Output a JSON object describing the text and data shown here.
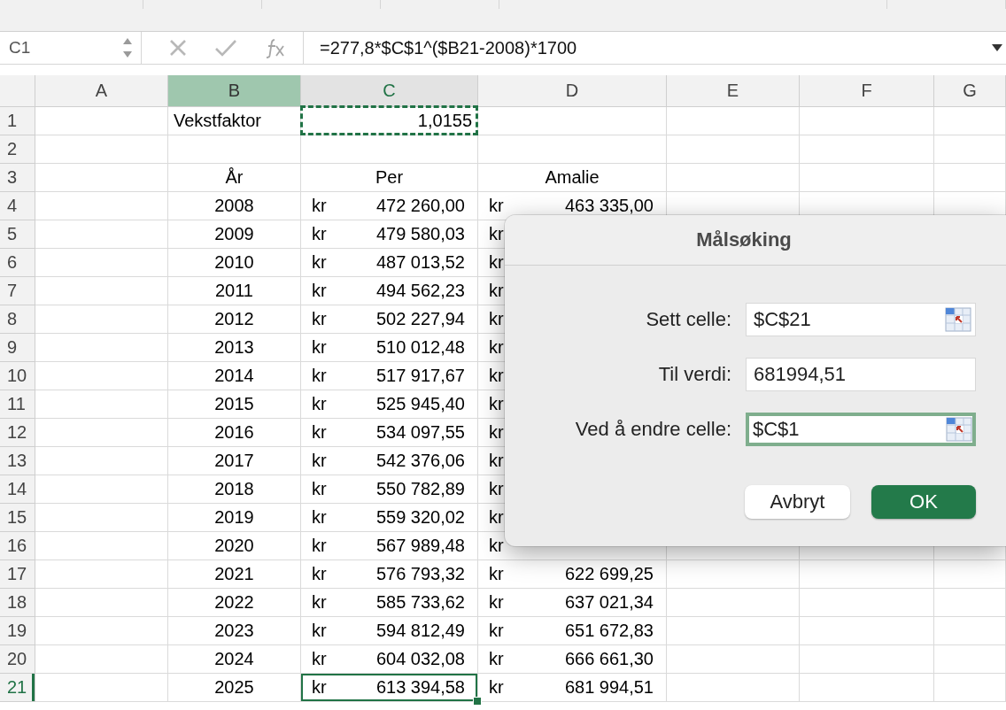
{
  "formula_bar": {
    "name_box": "C1",
    "cancel_enabled": false,
    "enter_enabled": false,
    "formula": "=277,8*$C$1^($B21-2008)*1700"
  },
  "columns": [
    {
      "label": "A",
      "selected": false,
      "highlighted": false
    },
    {
      "label": "B",
      "selected": false,
      "highlighted": true
    },
    {
      "label": "C",
      "selected": true,
      "highlighted": false
    },
    {
      "label": "D",
      "selected": false,
      "highlighted": false
    },
    {
      "label": "E",
      "selected": false,
      "highlighted": false
    },
    {
      "label": "F",
      "selected": false,
      "highlighted": false
    },
    {
      "label": "G",
      "selected": false,
      "highlighted": false
    }
  ],
  "rows": [
    {
      "number": "1",
      "current": false,
      "kind": "input",
      "b": "Vekstfaktor",
      "c": {
        "value": "1,0155",
        "marquee": true
      }
    },
    {
      "number": "2",
      "current": false,
      "kind": "blank"
    },
    {
      "number": "3",
      "current": false,
      "kind": "header",
      "b": "År",
      "c": "Per",
      "d": "Amalie"
    },
    {
      "number": "4",
      "current": false,
      "kind": "data",
      "b": "2008",
      "c": {
        "currency": "kr",
        "amount": "472 260,00",
        "active": false
      },
      "d": {
        "currency": "kr",
        "amount": "463 335,00"
      }
    },
    {
      "number": "5",
      "current": false,
      "kind": "data",
      "b": "2009",
      "c": {
        "currency": "kr",
        "amount": "479 580,03",
        "active": false
      },
      "d": {
        "currency": "kr"
      }
    },
    {
      "number": "6",
      "current": false,
      "kind": "data",
      "b": "2010",
      "c": {
        "currency": "kr",
        "amount": "487 013,52",
        "active": false
      },
      "d": {
        "currency": "kr"
      }
    },
    {
      "number": "7",
      "current": false,
      "kind": "data",
      "b": "2011",
      "c": {
        "currency": "kr",
        "amount": "494 562,23",
        "active": false
      },
      "d": {
        "currency": "kr"
      }
    },
    {
      "number": "8",
      "current": false,
      "kind": "data",
      "b": "2012",
      "c": {
        "currency": "kr",
        "amount": "502 227,94",
        "active": false
      },
      "d": {
        "currency": "kr"
      }
    },
    {
      "number": "9",
      "current": false,
      "kind": "data",
      "b": "2013",
      "c": {
        "currency": "kr",
        "amount": "510 012,48",
        "active": false
      },
      "d": {
        "currency": "kr"
      }
    },
    {
      "number": "10",
      "current": false,
      "kind": "data",
      "b": "2014",
      "c": {
        "currency": "kr",
        "amount": "517 917,67",
        "active": false
      },
      "d": {
        "currency": "kr"
      }
    },
    {
      "number": "11",
      "current": false,
      "kind": "data",
      "b": "2015",
      "c": {
        "currency": "kr",
        "amount": "525 945,40",
        "active": false
      },
      "d": {
        "currency": "kr"
      }
    },
    {
      "number": "12",
      "current": false,
      "kind": "data",
      "b": "2016",
      "c": {
        "currency": "kr",
        "amount": "534 097,55",
        "active": false
      },
      "d": {
        "currency": "kr"
      }
    },
    {
      "number": "13",
      "current": false,
      "kind": "data",
      "b": "2017",
      "c": {
        "currency": "kr",
        "amount": "542 376,06",
        "active": false
      },
      "d": {
        "currency": "kr"
      }
    },
    {
      "number": "14",
      "current": false,
      "kind": "data",
      "b": "2018",
      "c": {
        "currency": "kr",
        "amount": "550 782,89",
        "active": false
      },
      "d": {
        "currency": "kr"
      }
    },
    {
      "number": "15",
      "current": false,
      "kind": "data",
      "b": "2019",
      "c": {
        "currency": "kr",
        "amount": "559 320,02",
        "active": false
      },
      "d": {
        "currency": "kr"
      }
    },
    {
      "number": "16",
      "current": false,
      "kind": "data",
      "b": "2020",
      "c": {
        "currency": "kr",
        "amount": "567 989,48",
        "active": false
      },
      "d": {
        "currency": "kr"
      }
    },
    {
      "number": "17",
      "current": false,
      "kind": "data",
      "b": "2021",
      "c": {
        "currency": "kr",
        "amount": "576 793,32",
        "active": false
      },
      "d": {
        "currency": "kr",
        "amount": "622 699,25"
      }
    },
    {
      "number": "18",
      "current": false,
      "kind": "data",
      "b": "2022",
      "c": {
        "currency": "kr",
        "amount": "585 733,62",
        "active": false
      },
      "d": {
        "currency": "kr",
        "amount": "637 021,34"
      }
    },
    {
      "number": "19",
      "current": false,
      "kind": "data",
      "b": "2023",
      "c": {
        "currency": "kr",
        "amount": "594 812,49",
        "active": false
      },
      "d": {
        "currency": "kr",
        "amount": "651 672,83"
      }
    },
    {
      "number": "20",
      "current": false,
      "kind": "data",
      "b": "2024",
      "c": {
        "currency": "kr",
        "amount": "604 032,08",
        "active": false
      },
      "d": {
        "currency": "kr",
        "amount": "666 661,30"
      }
    },
    {
      "number": "21",
      "current": true,
      "kind": "data",
      "b": "2025",
      "c": {
        "currency": "kr",
        "amount": "613 394,58",
        "active": true
      },
      "d": {
        "currency": "kr",
        "amount": "681 994,51"
      }
    }
  ],
  "dialog": {
    "title": "Målsøking",
    "fields": [
      {
        "label": "Sett celle:",
        "value": "$C$21",
        "picker": true,
        "focused": false
      },
      {
        "label": "Til verdi:",
        "value": "681994,51",
        "picker": false,
        "focused": false
      },
      {
        "label": "Ved å endre celle:",
        "value": "$C$1",
        "picker": true,
        "focused": true
      }
    ],
    "buttons": [
      {
        "label": "Avbryt",
        "default": false
      },
      {
        "label": "OK",
        "default": true
      }
    ]
  }
}
